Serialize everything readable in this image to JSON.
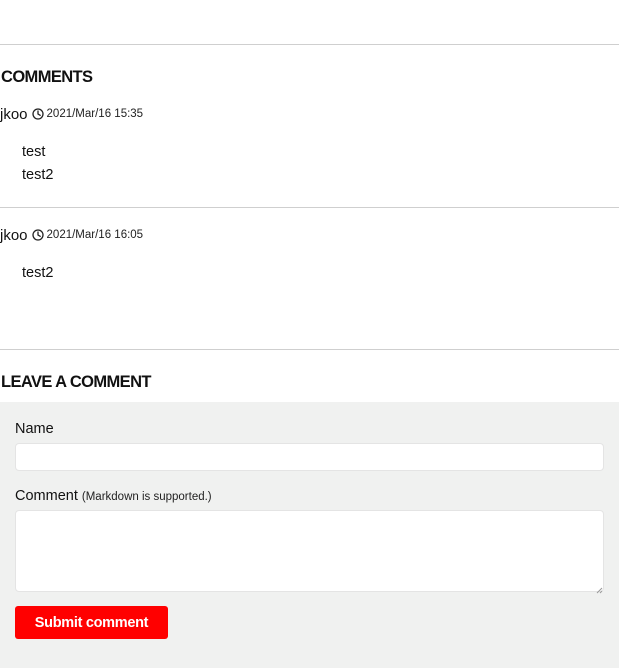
{
  "comments_section": {
    "title": "COMMENTS",
    "items": [
      {
        "author": "jkoo",
        "date": "2021/Mar/16 15:35",
        "lines": [
          "test",
          "test2"
        ]
      },
      {
        "author": "jkoo",
        "date": "2021/Mar/16 16:05",
        "lines": [
          "test2"
        ]
      }
    ]
  },
  "leave_comment": {
    "title": "LEAVE A COMMENT",
    "name_label": "Name",
    "name_value": "",
    "comment_label": "Comment",
    "comment_note": "(Markdown is supported.)",
    "comment_value": "",
    "submit_label": "Submit comment"
  },
  "icons": {
    "timestamp": "clock-icon",
    "resize": "resize-grip-icon"
  },
  "colors": {
    "accent": "#ff0000",
    "form_background": "#f0f1f0",
    "divider": "#cfcfcf"
  }
}
